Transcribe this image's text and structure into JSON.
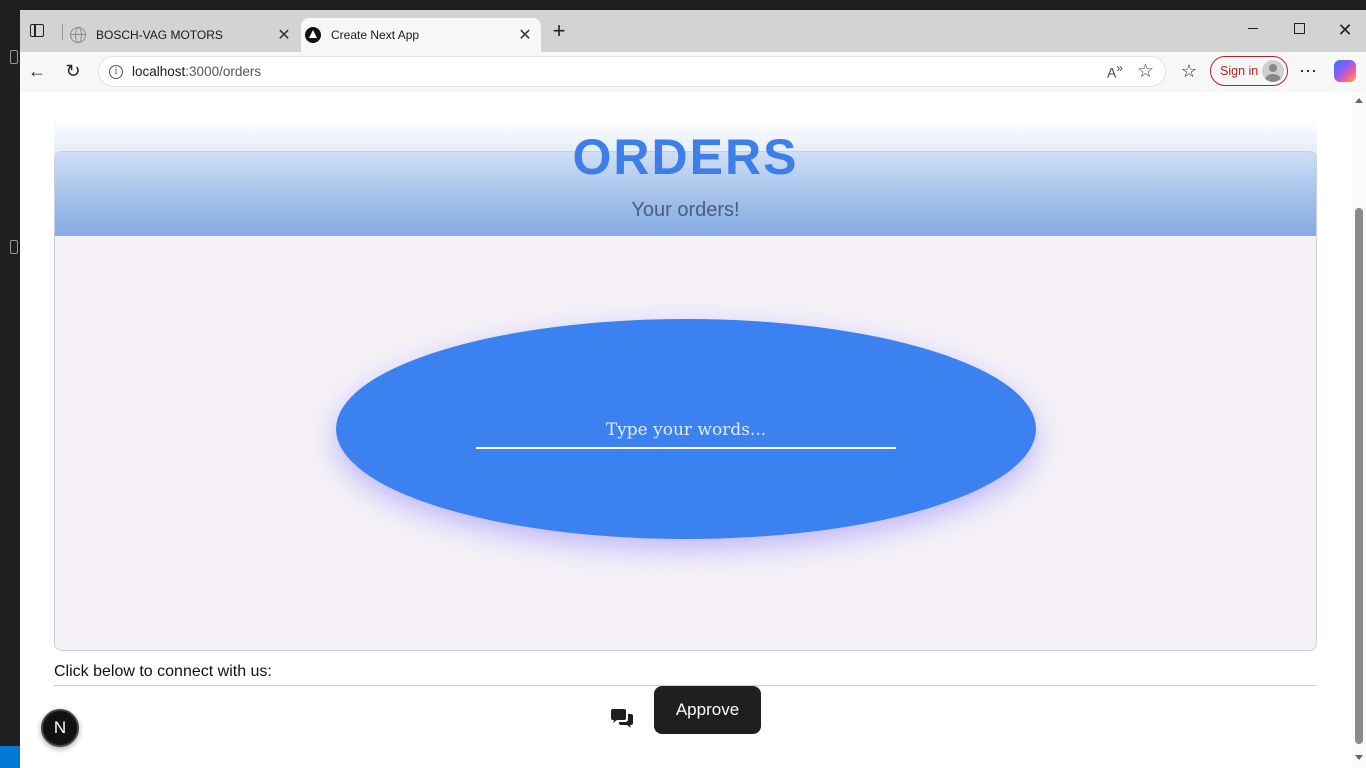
{
  "browser": {
    "tabs": [
      {
        "title": "BOSCH-VAG MOTORS",
        "favicon": "globe-icon",
        "active": false
      },
      {
        "title": "Create Next App",
        "favicon": "nextjs-icon",
        "active": true
      }
    ],
    "address": {
      "host": "localhost",
      "path": ":3000/orders"
    },
    "signin_label": "Sign in"
  },
  "page": {
    "title": "ORDERS",
    "subtitle": "Your orders!",
    "input_placeholder": "Type your words...",
    "connect_text": "Click below to connect with us:",
    "approve_label": "Approve",
    "badge_letter": "N"
  },
  "colors": {
    "accent": "#3b82f0",
    "title": "#3d7ee8",
    "button": "#1f1f1f",
    "card_body": "#f5f1f7"
  }
}
